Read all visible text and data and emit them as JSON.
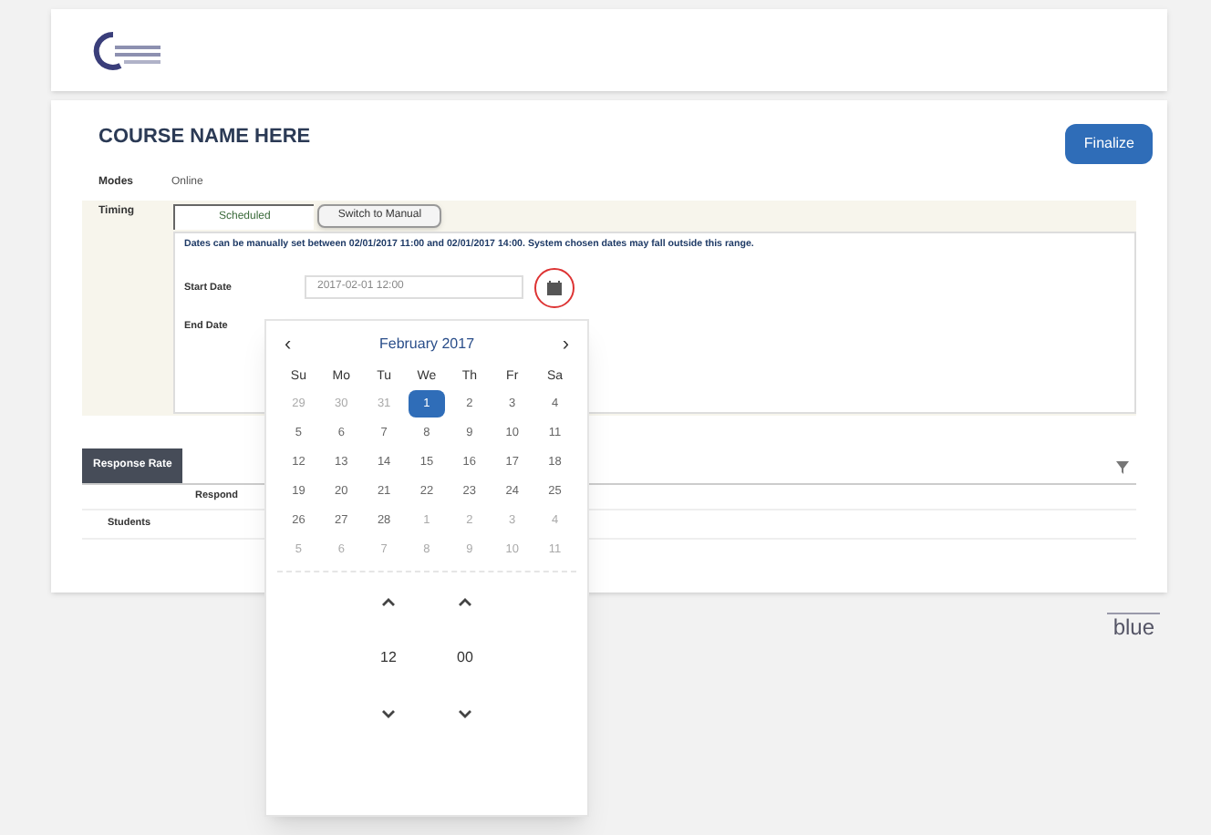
{
  "course": {
    "title": "COURSE NAME HERE",
    "button": "Finalize"
  },
  "modes": {
    "label": "Modes",
    "value": "Online"
  },
  "timing": {
    "label": "Timing",
    "tabs": [
      {
        "label": "Scheduled",
        "selected": true
      },
      {
        "label": "Switch to Manual",
        "selected": false
      }
    ],
    "notice": "Dates can be manually set between 02/01/2017 11:00 and 02/01/2017 14:00. System chosen dates may fall outside this range.",
    "start_date": {
      "label": "Start Date",
      "value": "2017-02-01 12:00"
    },
    "end_date": {
      "label": "End Date"
    }
  },
  "datepicker": {
    "month": "February 2017",
    "prev": "‹",
    "next": "›",
    "weekdays": [
      "Su",
      "Mo",
      "Tu",
      "We",
      "Th",
      "Fr",
      "Sa"
    ],
    "days": [
      {
        "label": "29",
        "muted": true,
        "selected": false
      },
      {
        "label": "30",
        "muted": true,
        "selected": false
      },
      {
        "label": "31",
        "muted": true,
        "selected": false
      },
      {
        "label": "1",
        "muted": false,
        "selected": true
      },
      {
        "label": "2",
        "muted": false,
        "selected": false
      },
      {
        "label": "3",
        "muted": false,
        "selected": false
      },
      {
        "label": "4",
        "muted": false,
        "selected": false
      },
      {
        "label": "5",
        "muted": false,
        "selected": false
      },
      {
        "label": "6",
        "muted": false,
        "selected": false
      },
      {
        "label": "7",
        "muted": false,
        "selected": false
      },
      {
        "label": "8",
        "muted": false,
        "selected": false
      },
      {
        "label": "9",
        "muted": false,
        "selected": false
      },
      {
        "label": "10",
        "muted": false,
        "selected": false
      },
      {
        "label": "11",
        "muted": false,
        "selected": false
      },
      {
        "label": "12",
        "muted": false,
        "selected": false
      },
      {
        "label": "13",
        "muted": false,
        "selected": false
      },
      {
        "label": "14",
        "muted": false,
        "selected": false
      },
      {
        "label": "15",
        "muted": false,
        "selected": false
      },
      {
        "label": "16",
        "muted": false,
        "selected": false
      },
      {
        "label": "17",
        "muted": false,
        "selected": false
      },
      {
        "label": "18",
        "muted": false,
        "selected": false
      },
      {
        "label": "19",
        "muted": false,
        "selected": false
      },
      {
        "label": "20",
        "muted": false,
        "selected": false
      },
      {
        "label": "21",
        "muted": false,
        "selected": false
      },
      {
        "label": "22",
        "muted": false,
        "selected": false
      },
      {
        "label": "23",
        "muted": false,
        "selected": false
      },
      {
        "label": "24",
        "muted": false,
        "selected": false
      },
      {
        "label": "25",
        "muted": false,
        "selected": false
      },
      {
        "label": "26",
        "muted": false,
        "selected": false
      },
      {
        "label": "27",
        "muted": false,
        "selected": false
      },
      {
        "label": "28",
        "muted": false,
        "selected": false
      },
      {
        "label": "1",
        "muted": true,
        "selected": false
      },
      {
        "label": "2",
        "muted": true,
        "selected": false
      },
      {
        "label": "3",
        "muted": true,
        "selected": false
      },
      {
        "label": "4",
        "muted": true,
        "selected": false
      },
      {
        "label": "5",
        "muted": true,
        "selected": false
      },
      {
        "label": "6",
        "muted": true,
        "selected": false
      },
      {
        "label": "7",
        "muted": true,
        "selected": false
      },
      {
        "label": "8",
        "muted": true,
        "selected": false
      },
      {
        "label": "9",
        "muted": true,
        "selected": false
      },
      {
        "label": "10",
        "muted": true,
        "selected": false
      },
      {
        "label": "11",
        "muted": true,
        "selected": false
      }
    ],
    "hour": "12",
    "minute": "00"
  },
  "response_rate": {
    "tab": "Response Rate",
    "column_1": "Respond",
    "row_label": "Students"
  },
  "footer_logo": "blue"
}
